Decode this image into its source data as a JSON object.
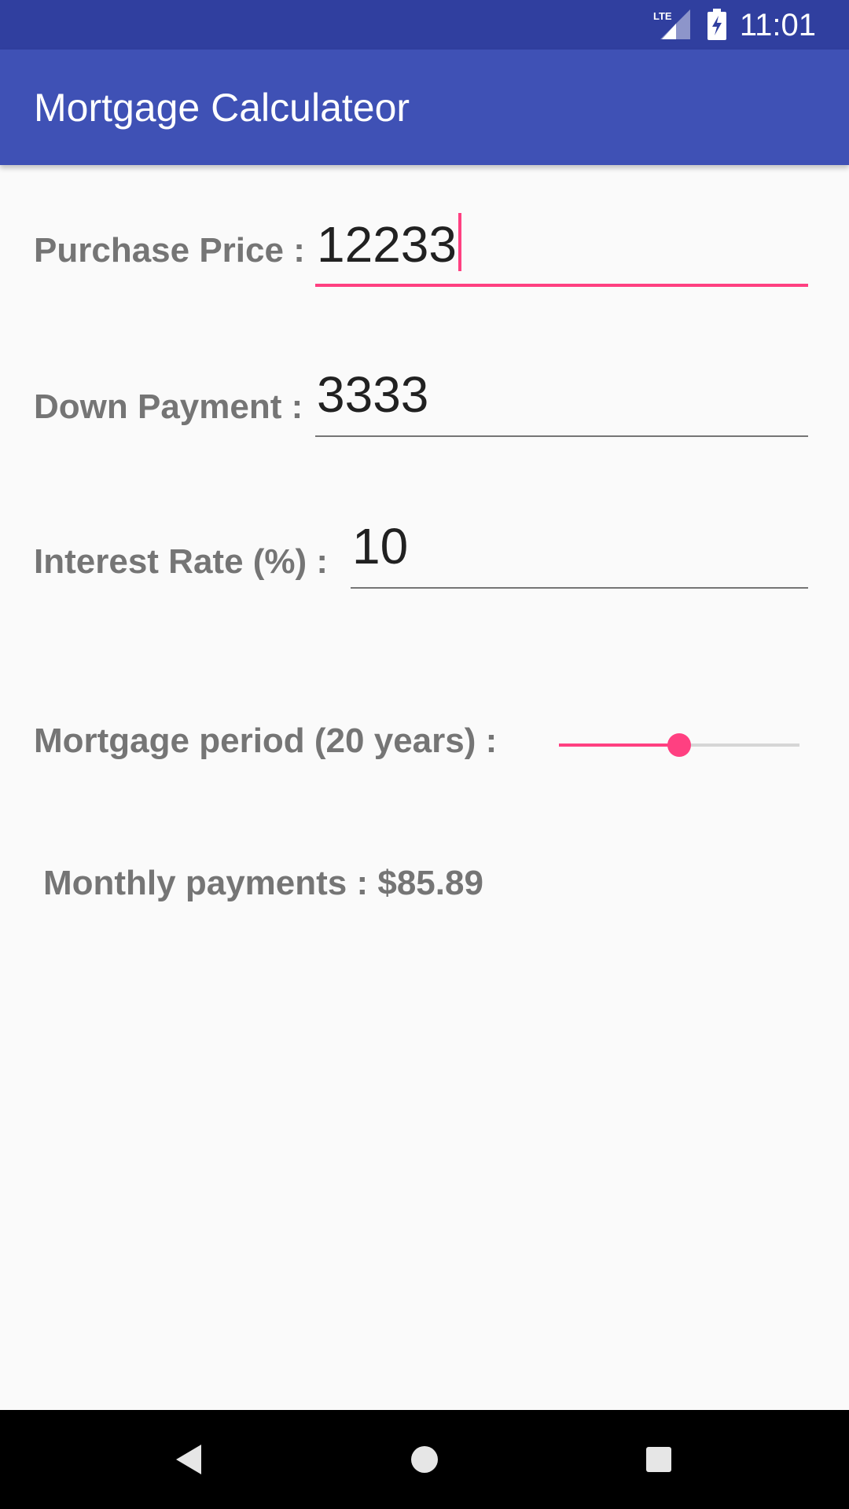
{
  "status_bar": {
    "network_label": "LTE",
    "time": "11:01",
    "icons": [
      "lte-signal-icon",
      "battery-charging-icon"
    ]
  },
  "app_bar": {
    "title": "Mortgage Calculateor"
  },
  "form": {
    "purchase_price": {
      "label": "Purchase Price :",
      "value": "12233"
    },
    "down_payment": {
      "label": "Down Payment :",
      "value": "3333"
    },
    "interest_rate": {
      "label": "Interest Rate (%) :",
      "value": "10"
    },
    "mortgage_period": {
      "label": "Mortgage period (20 years) :",
      "slider_fraction": 0.5
    },
    "monthly_payment": {
      "label": "Monthly payments : $85.89"
    }
  },
  "nav_bar": {
    "icons": [
      "back-icon",
      "home-icon",
      "recents-icon"
    ]
  },
  "colors": {
    "status_bar": "#303f9f",
    "app_bar": "#3f51b5",
    "accent": "#ff4081",
    "label_text": "#757575",
    "background": "#fafafa"
  }
}
